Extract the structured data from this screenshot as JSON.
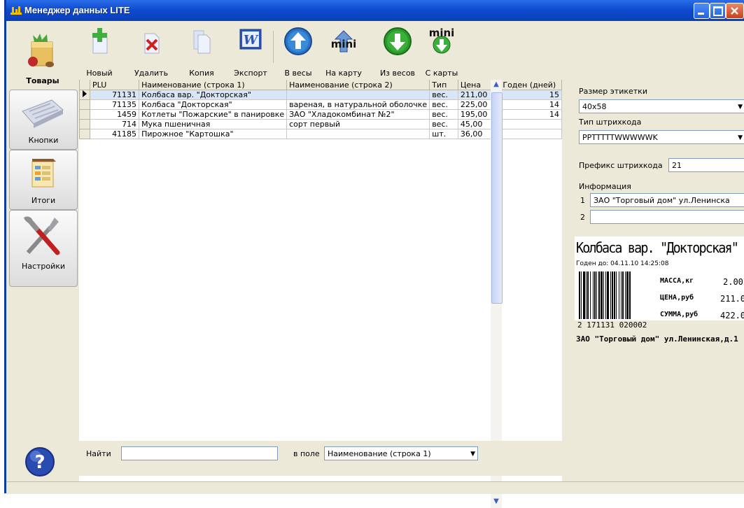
{
  "window": {
    "title": "Менеджер данных LITE"
  },
  "nav": [
    {
      "label": "Товары",
      "icon": "grocery-bag-icon",
      "active": true
    },
    {
      "label": "Кнопки",
      "icon": "keyboard-icon",
      "active": false
    },
    {
      "label": "Итоги",
      "icon": "report-icon",
      "active": false
    },
    {
      "label": "Настройки",
      "icon": "tools-icon",
      "active": false
    }
  ],
  "toolbar": {
    "new_label": "Новый",
    "delete_label": "Удалить",
    "copy_label": "Копия",
    "export_label": "Экспорт",
    "to_scales_label": "В весы",
    "to_card_label": "На карту",
    "from_scales_label": "Из весов",
    "from_card_label": "С карты",
    "mini_text": "mini"
  },
  "table": {
    "columns": [
      "PLU",
      "Наименование (строка 1)",
      "Наименование (строка 2)",
      "Тип",
      "Цена",
      "Годен (дней)"
    ],
    "rows": [
      {
        "plu": "71131",
        "name1": "Колбаса вар. \"Докторская\"",
        "name2": "",
        "type": "вес.",
        "price": "211,00",
        "days": "15",
        "selected": true
      },
      {
        "plu": "71135",
        "name1": "Колбаса \"Докторская\"",
        "name2": "вареная, в натуральной оболочке",
        "type": "вес.",
        "price": "225,00",
        "days": "14"
      },
      {
        "plu": "1459",
        "name1": "Котлеты \"Пожарские\" в панировке",
        "name2": "ЗАО \"Хладокомбинат №2\"",
        "type": "вес.",
        "price": "195,00",
        "days": "14"
      },
      {
        "plu": "714",
        "name1": "Мука пшеничная",
        "name2": "сорт первый",
        "type": "вес.",
        "price": "45,00",
        "days": ""
      },
      {
        "plu": "41185",
        "name1": "Пирожное \"Картошка\"",
        "name2": "",
        "type": "шт.",
        "price": "36,00",
        "days": ""
      }
    ]
  },
  "find": {
    "label": "Найти",
    "value": "",
    "field_label": "в поле",
    "field_value": "Наименование (строка 1)"
  },
  "panel": {
    "label_size_label": "Размер этикетки",
    "label_size_value": "40x58",
    "barcode_type_label": "Тип штрихкода",
    "barcode_type_value": "PPTTTTTWWWWWK",
    "prefix_label": "Префикс штрихкода",
    "prefix_value": "21",
    "info_label": "Информация",
    "info_rows": [
      {
        "num": "1",
        "value": "ЗАО \"Торговый дом\" ул.Ленинска"
      },
      {
        "num": "2",
        "value": ""
      }
    ]
  },
  "preview": {
    "title": "Колбаса вар. \"Докторская\"",
    "date_line": "Годен до: 04.11.10 14:25:08",
    "mass_label": "МАССА,кг",
    "mass_value": "2.00",
    "price_label": "ЦЕНА,руб",
    "price_value": "211.0",
    "sum_label": "СУММА,руб",
    "sum_value": "422.0",
    "barcode_digits": "2 171131 020002",
    "footer": "ЗАО \"Торговый дом\" ул.Ленинская,д.1"
  }
}
